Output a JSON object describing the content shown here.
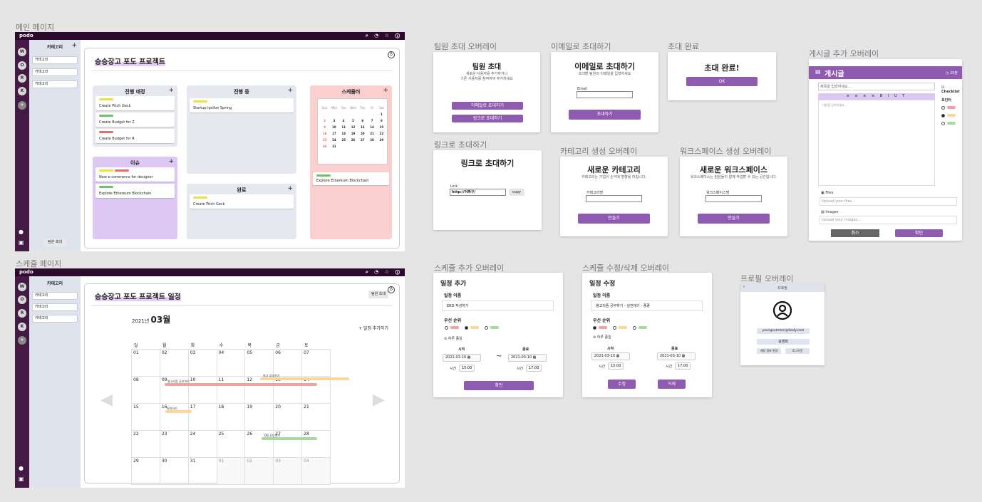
{
  "frames": {
    "main_page": "메인 페이지",
    "schedule_page": "스케쥴 페이지",
    "invite_overlay": "팀원 초대 오버레이",
    "email_invite": "이메일로 초대하기",
    "invite_done": "초대 완료",
    "post_overlay": "게시글 추가 오버레이",
    "link_invite": "링크로 초대하기",
    "category_overlay": "카테고리 생성 오버레이",
    "workspace_overlay": "워크스페이스 생성 오버레이",
    "schedule_add": "스케쥴 추가 오버레이",
    "schedule_edit": "스케쥴 수정/삭제 오버레이",
    "profile_overlay": "프로필 오버레이"
  },
  "app": {
    "brand": "podo",
    "top_icons": "⌕ ◔ ☆ ⓘ",
    "workspaces": [
      "W",
      "O",
      "R",
      "K"
    ],
    "add_ws": "+",
    "side_header": "카테고리",
    "side_plus": "+",
    "categories": [
      "카테고리",
      "카테고리",
      "카테고리"
    ],
    "invite_btn": "팀원 초대"
  },
  "main": {
    "title": "승승장고 포도 프로젝트",
    "columns": {
      "todo": {
        "title": "진행 예정",
        "cards": [
          "Create Pitch Geck",
          "Create Budget for Z",
          "Create Budget for R"
        ]
      },
      "doing": {
        "title": "진행 중",
        "cards": [
          "Startup Ipsilon Spring"
        ]
      },
      "issue": {
        "title": "이슈",
        "cards": [
          "New e-commerce for designer",
          "Explore Ethereum Blockchain"
        ]
      },
      "done": {
        "title": "완료",
        "cards": [
          "Create Pitch Geck"
        ]
      },
      "schedule": {
        "title": "스케쥴러",
        "cards": [
          "Explore Ethereum Blockchain"
        ]
      }
    },
    "mini_cal": {
      "header": [
        "Sun",
        "Mon",
        "Tue",
        "Wed",
        "Thu",
        "Fri",
        "Sat"
      ],
      "rows": [
        [
          "",
          "",
          "",
          "",
          "",
          "",
          "1"
        ],
        [
          "2",
          "3",
          "4",
          "5",
          "6",
          "7",
          "8"
        ],
        [
          "9",
          "10",
          "11",
          "12",
          "13",
          "14",
          "15"
        ],
        [
          "16",
          "17",
          "18",
          "19",
          "20",
          "21",
          "22"
        ],
        [
          "23",
          "24",
          "25",
          "26",
          "27",
          "28",
          "29"
        ],
        [
          "30",
          "31",
          "",
          "",
          "",
          "",
          ""
        ]
      ]
    }
  },
  "schedule": {
    "title": "승승장고 포도 프로젝트 일정",
    "invite_btn": "팀원 초대",
    "year": "2021년",
    "month": "03월",
    "add": "+ 일정 추가하기",
    "weekdays": [
      "일",
      "월",
      "화",
      "수",
      "목",
      "금",
      "토"
    ],
    "rows": [
      [
        "01",
        "02",
        "03",
        "04",
        "05",
        "06",
        "07"
      ],
      [
        "08",
        "09",
        "10",
        "11",
        "12",
        "13",
        "14"
      ],
      [
        "15",
        "16",
        "17",
        "18",
        "19",
        "20",
        "21"
      ],
      [
        "22",
        "23",
        "24",
        "25",
        "26",
        "27",
        "28"
      ],
      [
        "29",
        "30",
        "31",
        "01",
        "02",
        "03",
        "04"
      ]
    ],
    "events": [
      "알고리즘 공부하기",
      "최고 공부하기",
      "회의하기",
      "DB 공부하기"
    ]
  },
  "invite": {
    "title": "팀원 초대",
    "desc1": "새로운 사용자를 추가하거나",
    "desc2": "기존 사용자를 참여하여 추가하세요",
    "email_btn": "이메일로 초대하기",
    "link_btn": "링크로 초대하기"
  },
  "email": {
    "title": "이메일로 초대하기",
    "desc": "초대할 팀원의 이메일을 입력하세요",
    "label": "Email",
    "btn": "초대하기"
  },
  "done": {
    "title": "초대 완료!",
    "btn": "OK"
  },
  "link": {
    "title": "링크로 초대하기",
    "label": "Link",
    "value": "http://어쩌구/",
    "copy": "copy"
  },
  "category": {
    "title": "새로운 카테고리",
    "desc": "카테고리는 기업의 손익에 영향을 미칩니다.",
    "label": "카테고리명",
    "btn": "만들기"
  },
  "workspace": {
    "title": "새로운 워크스페이스",
    "desc": "워크스페이스는 팀원들이 함께 작업할 수 있는 공간입니다.",
    "label": "워크스페이스명",
    "btn": "만들기"
  },
  "post": {
    "header": "게시글",
    "header_right": "◷ 20분",
    "title_ph": "제목을 입력하세요...",
    "checklist": "Checklist",
    "toolbar": "≡ ≡ ≡ ≡ B I U T",
    "body_ph": "내용을 입력하세요...",
    "point": "포인터",
    "files": "Files",
    "files_ph": "Upload your files...",
    "images": "Images",
    "images_ph": "Upload your images...",
    "cancel": "취소",
    "ok": "확인"
  },
  "sched_add": {
    "title": "일정 추가",
    "name_label": "일정 이름",
    "name_value": "ERD 작성하기",
    "priority": "우선 순위",
    "sameday": "하루 종일",
    "start": "시작",
    "end": "종료",
    "start_date": "2021-03-10",
    "end_date": "2021-03-10",
    "time_label": "시간",
    "start_time": "15:00",
    "end_time": "17:00",
    "tilde": "~",
    "btn": "확인"
  },
  "sched_edit": {
    "title": "일정 수정",
    "name_label": "일정 이름",
    "name_value": "앵고리즘 공부하기 - 실전대기 - 종종",
    "priority": "우선 순위",
    "sameday": "하루 종일",
    "start": "시작",
    "end": "종료",
    "start_date": "2021-03-10",
    "end_date": "2021-03-10",
    "time_label": "시간",
    "start_time": "15:00",
    "end_time": "17:00",
    "edit": "수정",
    "delete": "삭제"
  },
  "profile": {
    "back": "‹",
    "header": "프로필",
    "email": "yeongsummer@toafy.com",
    "name": "김영희",
    "btn1": "계정 정보 변경",
    "btn2": "로그아웃"
  },
  "colors": {
    "purple": "#8e5bb0",
    "dark": "#2d0a2d",
    "yellow": "#f2df3a",
    "green": "#6cc56c",
    "red": "#e86b6b"
  }
}
